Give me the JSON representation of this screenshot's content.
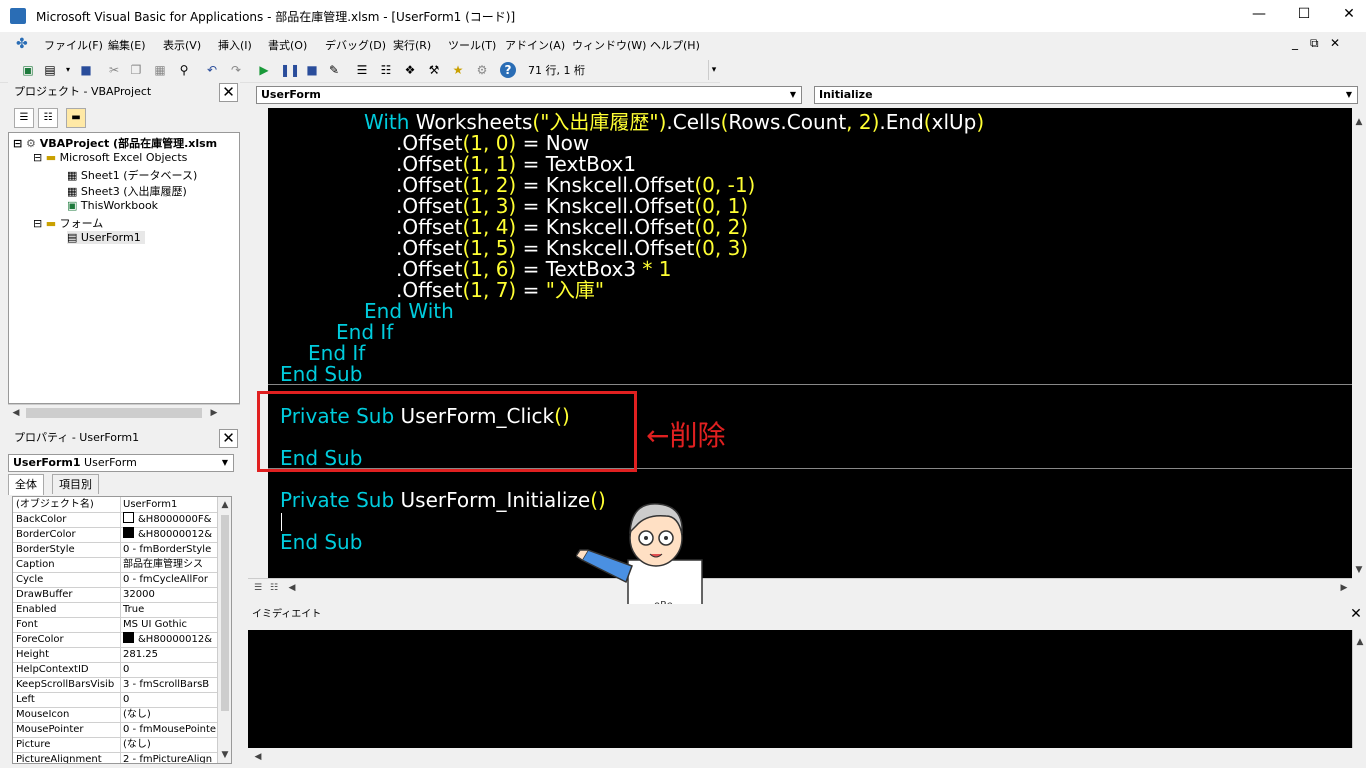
{
  "window": {
    "title": "Microsoft Visual Basic for Applications - 部品在庫管理.xlsm - [UserForm1 (コード)]",
    "minimize": "—",
    "maximize": "☐",
    "close": "✕",
    "app_icon": "vba-app-icon"
  },
  "menubar": {
    "items": [
      "ファイル(F)",
      "編集(E)",
      "表示(V)",
      "挿入(I)",
      "書式(O)",
      "デバッグ(D)",
      "実行(R)",
      "ツール(T)",
      "アドイン(A)",
      "ウィンドウ(W)",
      "ヘルプ(H)"
    ],
    "mdi_min": "_",
    "mdi_restore": "⧉",
    "mdi_close": "✕"
  },
  "toolbar": {
    "status": "71 行, 1 桁",
    "icons": [
      "excel-icon",
      "insert-icon",
      "save-icon",
      "cut-icon",
      "copy-icon",
      "paste-icon",
      "find-icon",
      "undo-icon",
      "redo-icon",
      "run-icon",
      "break-icon",
      "reset-icon",
      "design-mode-icon",
      "project-explorer-icon",
      "properties-icon",
      "object-browser-icon",
      "toolbox-icon",
      "tools-icon",
      "help-icon"
    ]
  },
  "project": {
    "header": "プロジェクト - VBAProject",
    "tree": [
      {
        "label": "VBAProject (部品在庫管理.xlsm",
        "level": 0,
        "bold": true
      },
      {
        "label": "Microsoft Excel Objects",
        "level": 1
      },
      {
        "label": "Sheet1 (データベース)",
        "level": 2
      },
      {
        "label": "Sheet3 (入出庫履歴)",
        "level": 2
      },
      {
        "label": "ThisWorkbook",
        "level": 2
      },
      {
        "label": "フォーム",
        "level": 1
      },
      {
        "label": "UserForm1",
        "level": 2
      }
    ]
  },
  "properties": {
    "header": "プロパティ - UserForm1",
    "object_name": "UserForm1",
    "object_type": "UserForm",
    "tabs": [
      "全体",
      "項目別"
    ],
    "rows": [
      {
        "name": "(オブジェクト名)",
        "value": "UserForm1"
      },
      {
        "name": "BackColor",
        "value": "&H8000000F&",
        "swatch": "#ffffff"
      },
      {
        "name": "BorderColor",
        "value": "&H80000012&",
        "swatch": "#000000"
      },
      {
        "name": "BorderStyle",
        "value": "0 - fmBorderStyle"
      },
      {
        "name": "Caption",
        "value": "部品在庫管理シス"
      },
      {
        "name": "Cycle",
        "value": "0 - fmCycleAllFor"
      },
      {
        "name": "DrawBuffer",
        "value": "32000"
      },
      {
        "name": "Enabled",
        "value": "True"
      },
      {
        "name": "Font",
        "value": "MS UI Gothic"
      },
      {
        "name": "ForeColor",
        "value": "&H80000012&",
        "swatch": "#000000"
      },
      {
        "name": "Height",
        "value": "281.25"
      },
      {
        "name": "HelpContextID",
        "value": "0"
      },
      {
        "name": "KeepScrollBarsVisib",
        "value": "3 - fmScrollBarsB"
      },
      {
        "name": "Left",
        "value": "0"
      },
      {
        "name": "MouseIcon",
        "value": "(なし)"
      },
      {
        "name": "MousePointer",
        "value": "0 - fmMousePointe"
      },
      {
        "name": "Picture",
        "value": "(なし)"
      },
      {
        "name": "PictureAlignment",
        "value": "2 - fmPictureAlign"
      }
    ]
  },
  "code": {
    "object_combo": "UserForm",
    "proc_combo": "Initialize",
    "lines": [
      [
        {
          "t": "With ",
          "c": "kw"
        },
        {
          "t": "Worksheets",
          "c": "tx"
        },
        {
          "t": "(\"入出庫履歴\")",
          "c": "nm"
        },
        {
          "t": ".Cells",
          "c": "tx"
        },
        {
          "t": "(",
          "c": "nm"
        },
        {
          "t": "Rows.Count",
          "c": "tx"
        },
        {
          "t": ", 2)",
          "c": "nm"
        },
        {
          "t": ".End",
          "c": "tx"
        },
        {
          "t": "(",
          "c": "nm"
        },
        {
          "t": "xlUp",
          "c": "tx"
        },
        {
          "t": ")",
          "c": "nm"
        }
      ],
      [
        {
          "t": ".Offset",
          "c": "tx"
        },
        {
          "t": "(1, 0)",
          "c": "nm"
        },
        {
          "t": " = Now",
          "c": "tx"
        }
      ],
      [
        {
          "t": ".Offset",
          "c": "tx"
        },
        {
          "t": "(1, 1)",
          "c": "nm"
        },
        {
          "t": " = TextBox1",
          "c": "tx"
        }
      ],
      [
        {
          "t": ".Offset",
          "c": "tx"
        },
        {
          "t": "(1, 2)",
          "c": "nm"
        },
        {
          "t": " = Knskcell.Offset",
          "c": "tx"
        },
        {
          "t": "(0, -1)",
          "c": "nm"
        }
      ],
      [
        {
          "t": ".Offset",
          "c": "tx"
        },
        {
          "t": "(1, 3)",
          "c": "nm"
        },
        {
          "t": " = Knskcell.Offset",
          "c": "tx"
        },
        {
          "t": "(0, 1)",
          "c": "nm"
        }
      ],
      [
        {
          "t": ".Offset",
          "c": "tx"
        },
        {
          "t": "(1, 4)",
          "c": "nm"
        },
        {
          "t": " = Knskcell.Offset",
          "c": "tx"
        },
        {
          "t": "(0, 2)",
          "c": "nm"
        }
      ],
      [
        {
          "t": ".Offset",
          "c": "tx"
        },
        {
          "t": "(1, 5)",
          "c": "nm"
        },
        {
          "t": " = Knskcell.Offset",
          "c": "tx"
        },
        {
          "t": "(0, 3)",
          "c": "nm"
        }
      ],
      [
        {
          "t": ".Offset",
          "c": "tx"
        },
        {
          "t": "(1, 6)",
          "c": "nm"
        },
        {
          "t": " = TextBox3 ",
          "c": "tx"
        },
        {
          "t": "* 1",
          "c": "nm"
        }
      ],
      [
        {
          "t": ".Offset",
          "c": "tx"
        },
        {
          "t": "(1, 7)",
          "c": "nm"
        },
        {
          "t": " = ",
          "c": "tx"
        },
        {
          "t": "\"入庫\"",
          "c": "nm"
        }
      ],
      [
        {
          "t": "End With",
          "c": "kw"
        }
      ],
      [
        {
          "t": "End If",
          "c": "kw"
        }
      ],
      [
        {
          "t": "End If",
          "c": "kw"
        }
      ],
      [
        {
          "t": "End Sub",
          "c": "kw"
        }
      ],
      [
        {
          "t": "Private Sub ",
          "c": "kw"
        },
        {
          "t": "UserForm_Click",
          "c": "tx"
        },
        {
          "t": "()",
          "c": "nm"
        }
      ],
      [],
      [
        {
          "t": "End Sub",
          "c": "kw"
        }
      ],
      [
        {
          "t": "Private Sub ",
          "c": "kw"
        },
        {
          "t": "UserForm_Initialize",
          "c": "tx"
        },
        {
          "t": "()",
          "c": "nm"
        }
      ],
      [],
      [
        {
          "t": "End Sub",
          "c": "kw"
        }
      ]
    ]
  },
  "annotation": {
    "delete_note": "←削除",
    "color": "#e02020"
  },
  "immediate": {
    "header": "イミディエイト"
  },
  "colors": {
    "keyword": "#00ccdd",
    "text": "#ffffff",
    "literal": "#ffff33",
    "code_bg": "#000000"
  }
}
